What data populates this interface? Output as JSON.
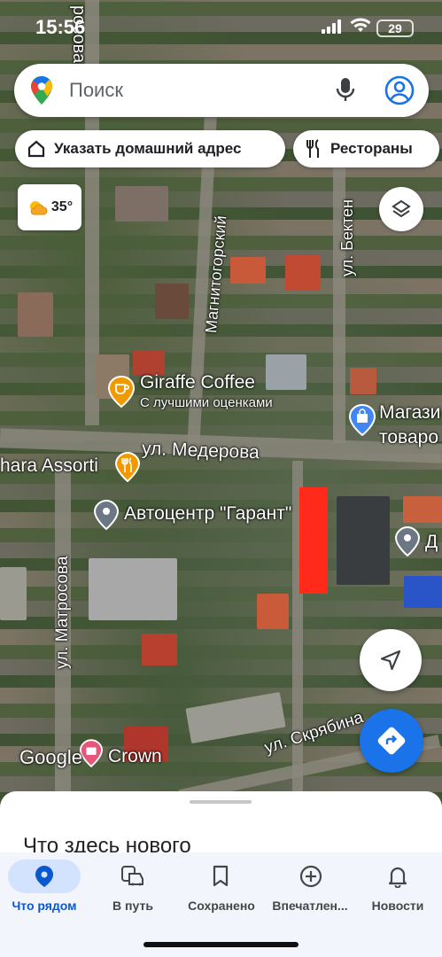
{
  "status_bar": {
    "time": "15:56",
    "battery": "29"
  },
  "search": {
    "placeholder": "Поиск"
  },
  "chips": [
    {
      "label": "Указать домашний адрес",
      "icon": "home-icon"
    },
    {
      "label": "Рестораны",
      "icon": "restaurant-icon"
    }
  ],
  "weather": {
    "temperature": "35°",
    "icon": "partly-sunny-icon"
  },
  "map": {
    "streets": [
      "ул. Медерова",
      "ул. Матросова",
      "Магнитогорский",
      "ул. Бектен",
      "ул. Скрябина",
      "росова"
    ],
    "pois": [
      {
        "name": "Giraffe Coffee",
        "subtitle": "С лучшими оценками"
      },
      {
        "name": "hara Assorti"
      },
      {
        "name": "Автоцентр \"Гарант\""
      },
      {
        "name": "Магази"
      },
      {
        "name": "товаро"
      },
      {
        "name": "Crown"
      },
      {
        "name": "Д"
      }
    ],
    "watermark": "Google"
  },
  "bottom_sheet": {
    "title": "Что здесь нового"
  },
  "nav": [
    {
      "label": "Что рядом",
      "icon": "location-pin-icon",
      "active": true
    },
    {
      "label": "В путь",
      "icon": "commute-icon",
      "active": false
    },
    {
      "label": "Сохранено",
      "icon": "bookmark-icon",
      "active": false
    },
    {
      "label": "Впечатлен...",
      "icon": "add-circle-icon",
      "active": false
    },
    {
      "label": "Новости",
      "icon": "bell-icon",
      "active": false
    }
  ],
  "colors": {
    "accent": "#1a73e8",
    "nav_active": "#0b57d0",
    "marker": "#ff2a1a"
  }
}
